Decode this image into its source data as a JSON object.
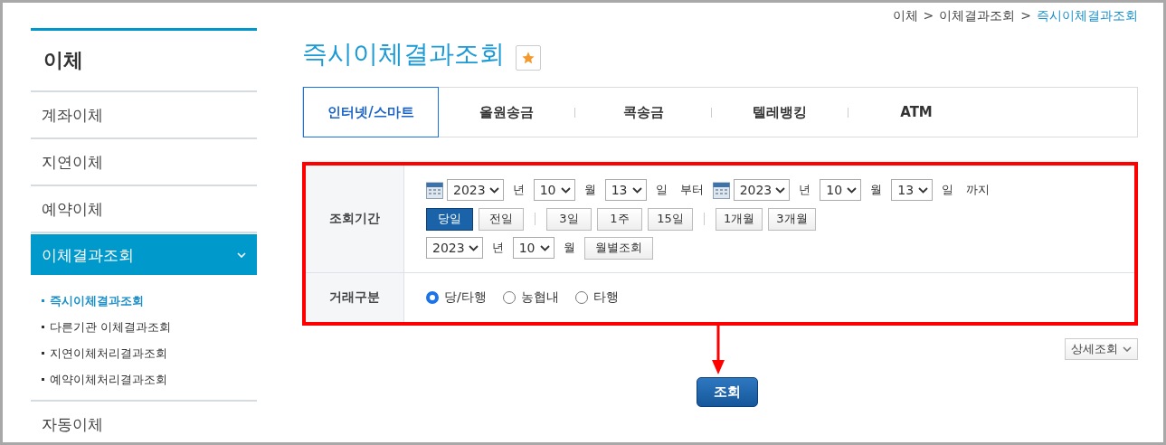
{
  "breadcrumb": [
    {
      "label": "이체",
      "current": false
    },
    {
      "label": ">",
      "current": false
    },
    {
      "label": "이체결과조회",
      "current": false
    },
    {
      "label": ">",
      "current": false
    },
    {
      "label": "즉시이체결과조회",
      "current": true
    }
  ],
  "sidebar": {
    "title": "이체",
    "items": [
      {
        "label": "계좌이체",
        "selected": false
      },
      {
        "label": "지연이체",
        "selected": false
      },
      {
        "label": "예약이체",
        "selected": false
      },
      {
        "label": "이체결과조회",
        "selected": true,
        "expanded": true,
        "children": [
          {
            "label": "즉시이체결과조회",
            "selected": true
          },
          {
            "label": "다른기관 이체결과조회",
            "selected": false
          },
          {
            "label": "지연이체처리결과조회",
            "selected": false
          },
          {
            "label": "예약이체처리결과조회",
            "selected": false
          }
        ]
      },
      {
        "label": "자동이체",
        "selected": false
      }
    ]
  },
  "page_title": "즉시이체결과조회",
  "tabs": [
    {
      "label": "인터넷/스마트",
      "selected": true
    },
    {
      "label": "올원송금",
      "selected": false
    },
    {
      "label": "콕송금",
      "selected": false
    },
    {
      "label": "텔레뱅킹",
      "selected": false
    },
    {
      "label": "ATM",
      "selected": false
    }
  ],
  "period": {
    "label": "조회기간",
    "from": [
      {
        "value": "2023",
        "unit": "년"
      },
      {
        "value": "10",
        "unit": "월"
      },
      {
        "value": "13",
        "unit": "일"
      }
    ],
    "from_suffix": "부터",
    "to": [
      {
        "value": "2023",
        "unit": "년"
      },
      {
        "value": "10",
        "unit": "월"
      },
      {
        "value": "13",
        "unit": "일"
      }
    ],
    "to_suffix": "까지",
    "quick_groups": [
      [
        {
          "label": "당일",
          "selected": true
        },
        {
          "label": "전일",
          "selected": false
        }
      ],
      [
        {
          "label": "3일",
          "selected": false
        },
        {
          "label": "1주",
          "selected": false
        },
        {
          "label": "15일",
          "selected": false
        }
      ],
      [
        {
          "label": "1개월",
          "selected": false
        },
        {
          "label": "3개월",
          "selected": false
        }
      ]
    ],
    "month": [
      {
        "value": "2023",
        "unit": "년"
      },
      {
        "value": "10",
        "unit": "월"
      }
    ],
    "month_button": "월별조회"
  },
  "type": {
    "label": "거래구분",
    "options": [
      {
        "label": "당/타행",
        "selected": true
      },
      {
        "label": "농협내",
        "selected": false
      },
      {
        "label": "타행",
        "selected": false
      }
    ]
  },
  "detail_button": "상세조회",
  "search_button": "조회"
}
